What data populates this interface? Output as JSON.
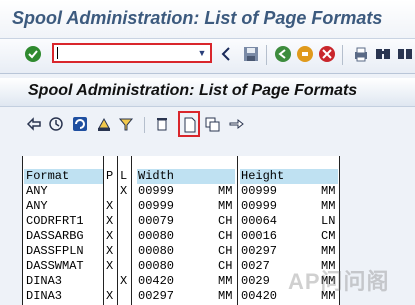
{
  "window": {
    "title": "Spool Administration: List of Page Formats"
  },
  "toolbar": {
    "command_value": ""
  },
  "screen": {
    "title": "Spool Administration: List of Page Formats"
  },
  "list": {
    "columns": {
      "format": "Format",
      "p": "P",
      "l": "L",
      "width": "Width",
      "height": "Height"
    },
    "rows": [
      {
        "format": "ANY",
        "p": "",
        "l": "X",
        "width": "00999",
        "wunit": "MM",
        "height": "00999",
        "hunit": "MM"
      },
      {
        "format": "ANY",
        "p": "X",
        "l": "",
        "width": "00999",
        "wunit": "MM",
        "height": "00999",
        "hunit": "MM"
      },
      {
        "format": "CODRFRT1",
        "p": "X",
        "l": "",
        "width": "00079",
        "wunit": "CH",
        "height": "00064",
        "hunit": "LN"
      },
      {
        "format": "DASSARBG",
        "p": "X",
        "l": "",
        "width": "00080",
        "wunit": "CH",
        "height": "00016",
        "hunit": "CM"
      },
      {
        "format": "DASSFPLN",
        "p": "X",
        "l": "",
        "width": "00080",
        "wunit": "CH",
        "height": "00297",
        "hunit": "MM"
      },
      {
        "format": "DASSWMAT",
        "p": "X",
        "l": "",
        "width": "00080",
        "wunit": "CH",
        "height": "0027",
        "hunit": "MM"
      },
      {
        "format": "DINA3",
        "p": "",
        "l": "X",
        "width": "00420",
        "wunit": "MM",
        "height": "0029",
        "hunit": "MM"
      },
      {
        "format": "DINA3",
        "p": "X",
        "l": "",
        "width": "00297",
        "wunit": "MM",
        "height": "00420",
        "hunit": "MM"
      }
    ]
  },
  "watermark": {
    "text": "AP问问阁"
  }
}
